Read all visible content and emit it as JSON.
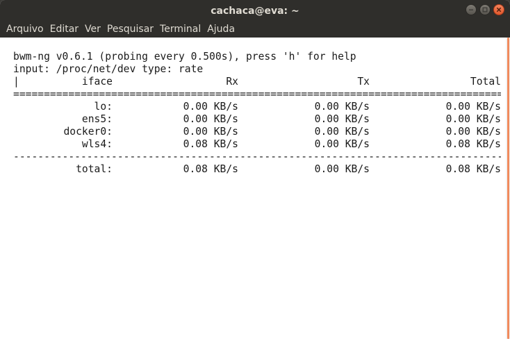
{
  "window": {
    "title": "cachaca@eva: ~"
  },
  "menu": {
    "items": [
      "Arquivo",
      "Editar",
      "Ver",
      "Pesquisar",
      "Terminal",
      "Ajuda"
    ]
  },
  "terminal": {
    "header_line1": "bwm-ng v0.6.1 (probing every 0.500s), press 'h' for help",
    "header_line2": "input: /proc/net/dev type: rate",
    "columns": {
      "pipe": "|",
      "iface": "iface",
      "rx": "Rx",
      "tx": "Tx",
      "total": "Total"
    },
    "separator_double": "===========================================================================================",
    "separator_single": "-------------------------------------------------------------------------------------------",
    "rows": [
      {
        "iface": "lo:",
        "rx": "0.00 KB/s",
        "tx": "0.00 KB/s",
        "total": "0.00 KB/s"
      },
      {
        "iface": "ens5:",
        "rx": "0.00 KB/s",
        "tx": "0.00 KB/s",
        "total": "0.00 KB/s"
      },
      {
        "iface": "docker0:",
        "rx": "0.00 KB/s",
        "tx": "0.00 KB/s",
        "total": "0.00 KB/s"
      },
      {
        "iface": "wls4:",
        "rx": "0.08 KB/s",
        "tx": "0.00 KB/s",
        "total": "0.08 KB/s"
      }
    ],
    "total_row": {
      "iface": "total:",
      "rx": "0.08 KB/s",
      "tx": "0.00 KB/s",
      "total": "0.08 KB/s"
    }
  },
  "colors": {
    "titlebar": "#2f2e2b",
    "close_button": "#e95420",
    "scrollbar_thumb": "#f08a5c"
  }
}
